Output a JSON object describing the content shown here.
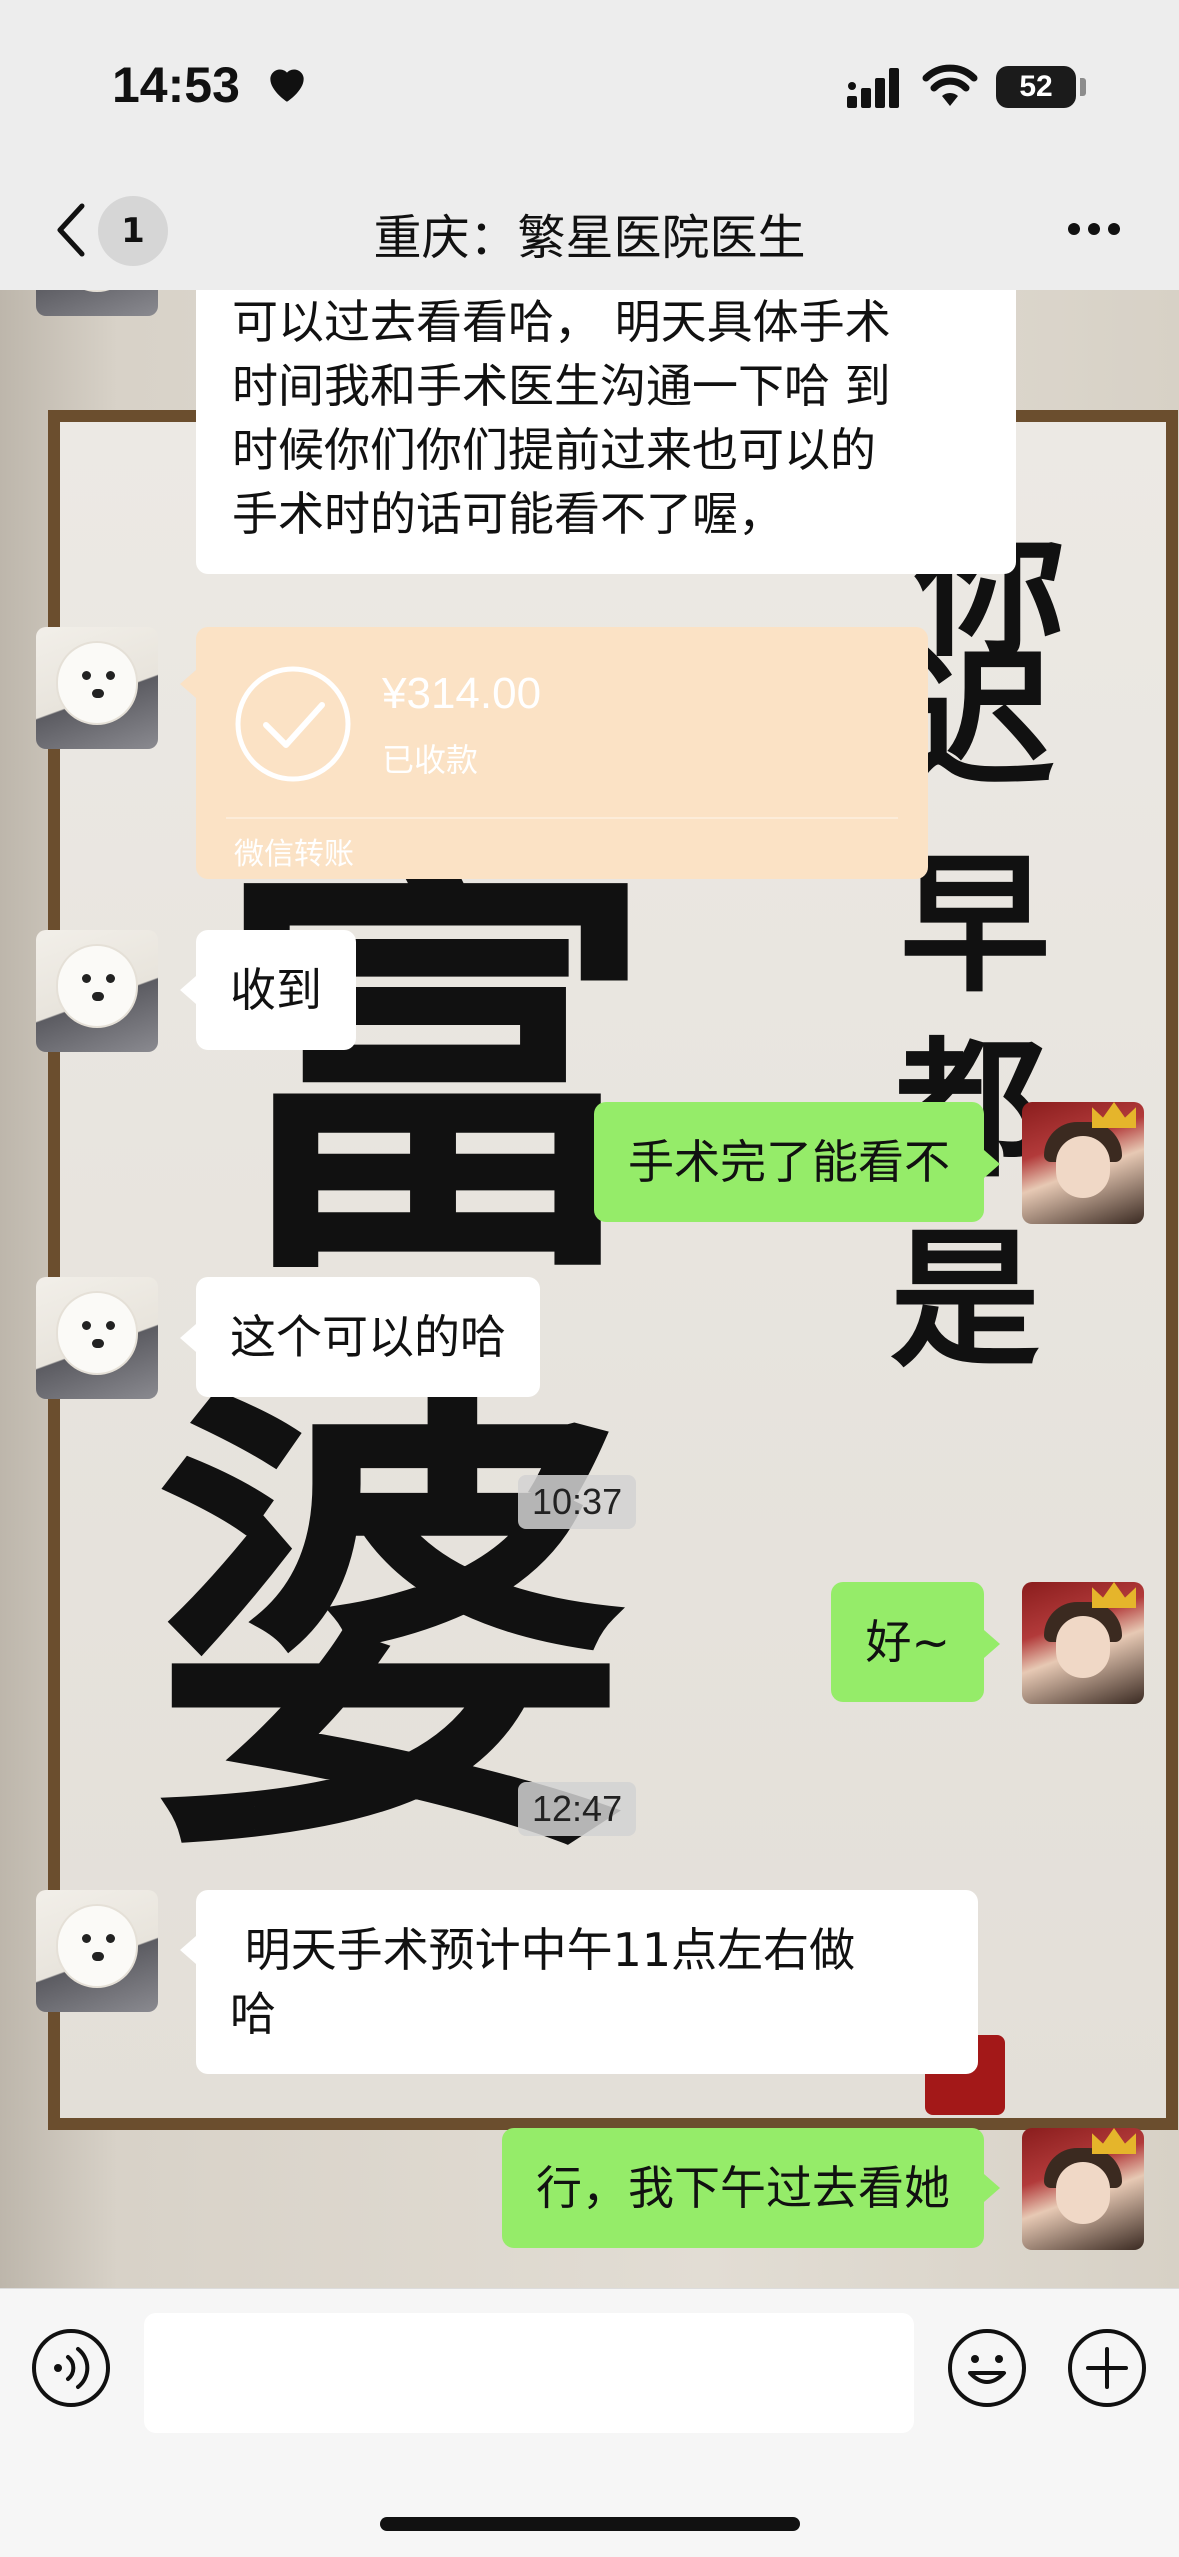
{
  "status_bar": {
    "time": "14:53",
    "battery": "52"
  },
  "header": {
    "unread_count": "1",
    "title": "重庆：繁星医院医生"
  },
  "messages": [
    {
      "from": "doctor",
      "text": "可以过去看看哈， 明天具体手术时间我和手术医生沟通一下哈 到时候你们你们提前过来也可以的 手术时的话可能看不了喔，",
      "lines": [
        "可以过去看看哈， 明天具体手术",
        "时间我和手术医生沟通一下哈 到",
        "时候你们你们提前过来也可以的",
        "手术时的话可能看不了喔，"
      ]
    },
    {
      "from": "doctor",
      "type": "transfer",
      "amount": "¥314.00",
      "status": "已收款",
      "label": "微信转账"
    },
    {
      "from": "doctor",
      "text": "收到"
    },
    {
      "from": "me",
      "text": "手术完了能看不"
    },
    {
      "from": "doctor",
      "text": "这个可以的哈"
    },
    {
      "type": "timestamp",
      "text": "10:37"
    },
    {
      "from": "me",
      "text": "好~"
    },
    {
      "type": "timestamp",
      "text": "12:47"
    },
    {
      "from": "doctor",
      "lines": [
        " 明天手术预计中午11点左右做",
        "哈"
      ]
    },
    {
      "from": "me",
      "text": "行，我下午过去看她"
    }
  ],
  "wallpaper_text": [
    "你",
    "迟",
    "早",
    "都",
    "是",
    "富",
    "婆"
  ],
  "input": {
    "placeholder": "",
    "value": ""
  },
  "icons": [
    "heart-icon",
    "signal-icon",
    "wifi-icon",
    "battery-icon",
    "back-chevron-icon",
    "more-icon",
    "check-circle-icon",
    "voice-icon",
    "emoji-icon",
    "plus-icon"
  ],
  "colors": {
    "outgoing_bubble": "#95ec69",
    "incoming_bubble": "#ffffff",
    "transfer_card": "#fbe2c5",
    "header_bg": "#ededed"
  }
}
